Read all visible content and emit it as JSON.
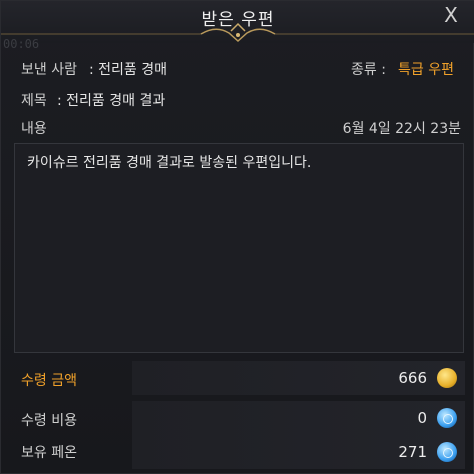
{
  "window": {
    "title": "받은 우편",
    "close_label": "X",
    "bg_timer": "00:06"
  },
  "mail": {
    "sender_label": "보낸 사람",
    "sender_value": ": 전리품 경매",
    "type_label": "종류 :",
    "type_value": "특급 우편",
    "subject_label": "제목",
    "subject_value": ": 전리품 경매 결과",
    "body_label": "내용",
    "date": "6월 4일 22시 23분",
    "body_text": "카이슈르 전리품 경매 결과로 발송된 우편입니다."
  },
  "amounts": {
    "receive_amount_label": "수령 금액",
    "receive_amount_value": "666",
    "receive_fee_label": "수령 비용",
    "receive_fee_value": "0",
    "owned_label": "보유 페온",
    "owned_value": "271"
  },
  "colors": {
    "accent": "#f0a12a",
    "gold_coin": "#e7b02a",
    "blue_coin": "#3a9ff0"
  },
  "icons": {
    "close": "close-icon",
    "gold": "gold-coin-icon",
    "peon": "peon-icon"
  }
}
